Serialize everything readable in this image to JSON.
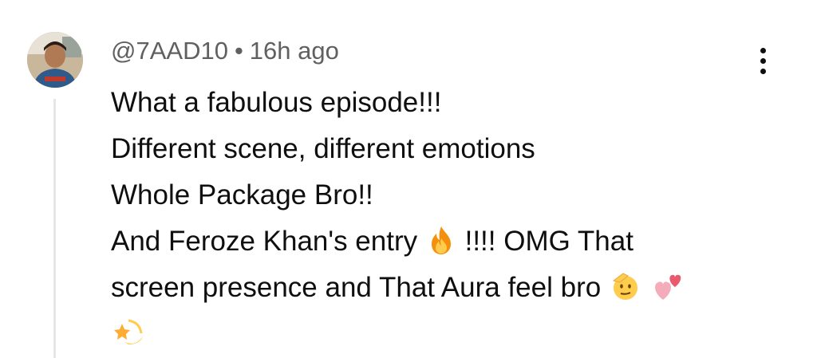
{
  "comment": {
    "author": "@7AAD10",
    "separator": "•",
    "time": "16h ago",
    "lines": [
      "What a fabulous episode!!!",
      "Different scene, different emotions",
      "Whole Package Bro!!"
    ],
    "line4_before": "And Feroze Khan's entry",
    "line4_after": "!!!! OMG That",
    "line5_before": "screen presence and That Aura feel bro",
    "icons": {
      "avatar": "user-avatar",
      "fire": "fire-icon",
      "saluting_face": "saluting-face-icon",
      "two_hearts": "two-hearts-icon",
      "dizzy": "dizzy-star-icon",
      "more": "more-vertical-icon"
    }
  }
}
